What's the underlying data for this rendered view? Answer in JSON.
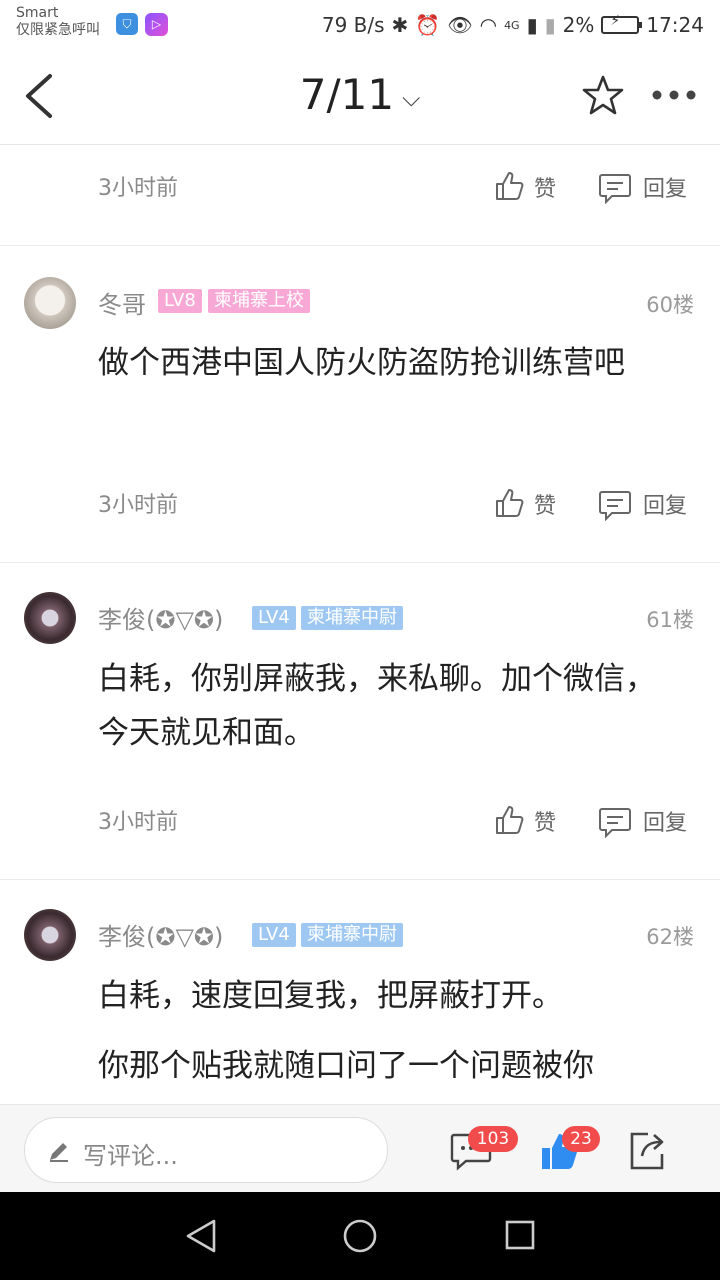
{
  "status_bar": {
    "carrier_line1": "Smart",
    "carrier_line2": "仅限紧急呼叫",
    "speed": "79 B/s",
    "battery": "2%",
    "time": "17:24",
    "network": "4G"
  },
  "nav": {
    "page_indicator": "7/11"
  },
  "first_footer": {
    "time": "3小时前",
    "like_label": "赞",
    "reply_label": "回复"
  },
  "comments": [
    {
      "username": "冬哥",
      "level": "LV8",
      "title": "柬埔寨上校",
      "floor": "60楼",
      "content": "做个西港中国人防火防盗防抢训练营吧",
      "time": "3小时前",
      "like_label": "赞",
      "reply_label": "回复"
    },
    {
      "username": "李俊(✪▽✪)",
      "level": "LV4",
      "title": "柬埔寨中尉",
      "floor": "61楼",
      "content": "白耗，你别屏蔽我，来私聊。加个微信，今天就见和面。",
      "time": "3小时前",
      "like_label": "赞",
      "reply_label": "回复"
    },
    {
      "username": "李俊(✪▽✪)",
      "level": "LV4",
      "title": "柬埔寨中尉",
      "floor": "62楼",
      "content": "白耗，速度回复我，把屏蔽打开。",
      "content2": "你那个贴我就随口问了一个问题被你"
    }
  ],
  "bottom_bar": {
    "placeholder": "写评论...",
    "comment_count": "103",
    "like_count": "23"
  },
  "colors": {
    "level_pink": "#f7a8d4",
    "level_blue": "#9ec8f2",
    "badge_red": "#f24b4b",
    "like_blue": "#2f8cf0"
  }
}
